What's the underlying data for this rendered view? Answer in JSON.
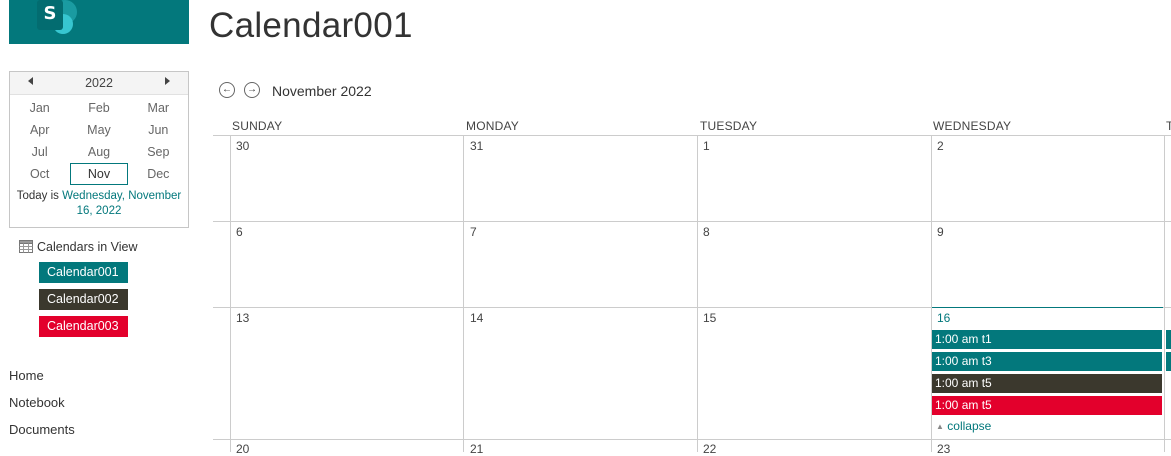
{
  "page": {
    "title": "Calendar001"
  },
  "datepicker": {
    "year": "2022",
    "months": [
      "Jan",
      "Feb",
      "Mar",
      "Apr",
      "May",
      "Jun",
      "Jul",
      "Aug",
      "Sep",
      "Oct",
      "Nov",
      "Dec"
    ],
    "selected_month": "Nov",
    "today_prefix": "Today is ",
    "today_link": "Wednesday, November 16, 2022"
  },
  "calendars_in_view": {
    "label": "Calendars in View",
    "items": [
      {
        "label": "Calendar001",
        "color": "#03787c"
      },
      {
        "label": "Calendar002",
        "color": "#3b382d"
      },
      {
        "label": "Calendar003",
        "color": "#e3002c"
      }
    ]
  },
  "left_nav": {
    "items": [
      "Home",
      "Notebook",
      "Documents"
    ]
  },
  "calendar": {
    "month_label": "November 2022",
    "day_headers": [
      "SUNDAY",
      "MONDAY",
      "TUESDAY",
      "WEDNESDAY",
      "T"
    ],
    "weeks": [
      [
        "30",
        "31",
        "1",
        "2"
      ],
      [
        "6",
        "7",
        "8",
        "9"
      ],
      [
        "13",
        "14",
        "15",
        "16"
      ],
      [
        "20",
        "21",
        "22",
        "23"
      ]
    ],
    "today": "16",
    "events": [
      {
        "label": "1:00 am t1",
        "color": "#03787c"
      },
      {
        "label": "1:00 am t3",
        "color": "#03787c"
      },
      {
        "label": "1:00 am t5",
        "color": "#3b382d"
      },
      {
        "label": "1:00 am t5",
        "color": "#e3002c"
      }
    ],
    "collapse_label": "collapse"
  },
  "colors": {
    "accent": "#03787c"
  }
}
